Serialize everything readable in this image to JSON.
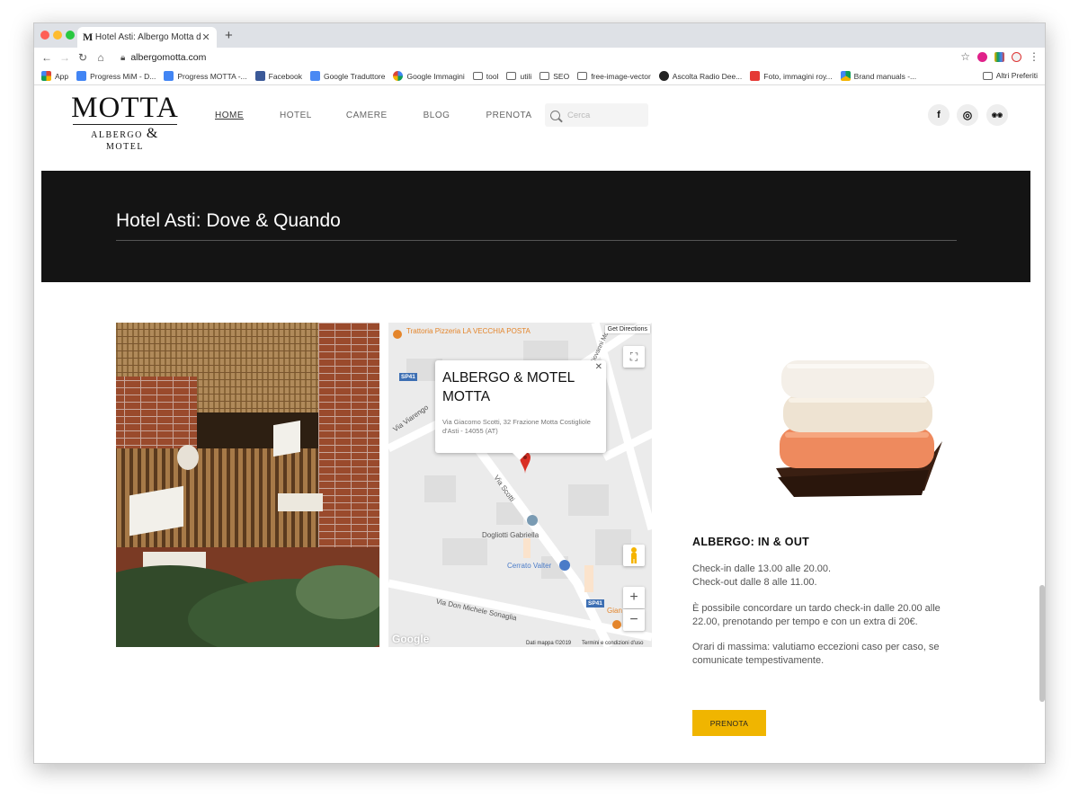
{
  "browser": {
    "tab_title": "Hotel Asti: Albergo Motta di Co",
    "tab_favicon": "M",
    "url": "albergomotta.com",
    "bookmarks": [
      {
        "label": "App",
        "icon": "apps-grid-icon"
      },
      {
        "label": "Progress MiM - D...",
        "icon": "docs-icon"
      },
      {
        "label": "Progress MOTTA -...",
        "icon": "docs-icon"
      },
      {
        "label": "Facebook",
        "icon": "facebook-icon"
      },
      {
        "label": "Google Traduttore",
        "icon": "translate-icon"
      },
      {
        "label": "Google Immagini",
        "icon": "google-icon"
      },
      {
        "label": "tool",
        "icon": "folder-icon"
      },
      {
        "label": "utili",
        "icon": "folder-icon"
      },
      {
        "label": "SEO",
        "icon": "folder-icon"
      },
      {
        "label": "free-image-vector",
        "icon": "folder-icon"
      },
      {
        "label": "Ascolta Radio Dee...",
        "icon": "radio-icon"
      },
      {
        "label": "Foto, immagini roy...",
        "icon": "photo-icon"
      },
      {
        "label": "Brand manuals -...",
        "icon": "drive-icon"
      }
    ],
    "other_bookmarks": "Altri Preferiti"
  },
  "site": {
    "logo": {
      "big": "MOTTA",
      "small_left": "ALBERGO",
      "amp": "&",
      "small_right": "MOTEL"
    },
    "nav": [
      "HOME",
      "HOTEL",
      "CAMERE",
      "BLOG",
      "PRENOTA"
    ],
    "search_placeholder": "Cerca",
    "social": [
      {
        "icon": "facebook-icon",
        "glyph": "f"
      },
      {
        "icon": "instagram-icon",
        "glyph": "◎"
      },
      {
        "icon": "tripadvisor-icon",
        "glyph": "◉◉"
      }
    ]
  },
  "banner": {
    "title": "Hotel Asti: Dove & Quando"
  },
  "map": {
    "get_directions": "Get Directions",
    "info_name": "ALBERGO & MOTEL MOTTA",
    "info_address": "Via Giacomo Scotti, 32 Frazione Motta Costigliole d'Asti - 14055 (AT)",
    "labels": {
      "trattoria": "Trattoria Pizzeria LA VECCHIA POSTA",
      "sp41": "SP41",
      "via_viarengo": "Via Viarengo",
      "via_scotti": "Via Scotti",
      "via_giovanni": "Via Giovanni Mont",
      "dogliotti": "Dogliotti Gabriella",
      "cerrato": "Cerrato Valter",
      "via_sonaglia": "Via Don Michele Sonaglia",
      "gian": "Gian"
    },
    "google": "Google",
    "map_data": "Dati mappa ©2019",
    "terms": "Termini e condizioni d'uso"
  },
  "inout": {
    "heading": "ALBERGO: IN & OUT",
    "p1_line1": "Check-in dalle 13.00 alle 20.00.",
    "p1_line2": "Check-out dalle 8 alle 11.00.",
    "p2": "È possibile concordare un tardo check-in dalle 20.00 alle 22.00, prenotando per tempo e con un extra di 20€.",
    "p3": "Orari di massima: valutiamo eccezioni caso per caso, se comunicate tempestivamente.",
    "button": "PRENOTA"
  },
  "colors": {
    "banner_bg": "#141414",
    "accent": "#f0b500",
    "map_pin": "#d93025"
  }
}
